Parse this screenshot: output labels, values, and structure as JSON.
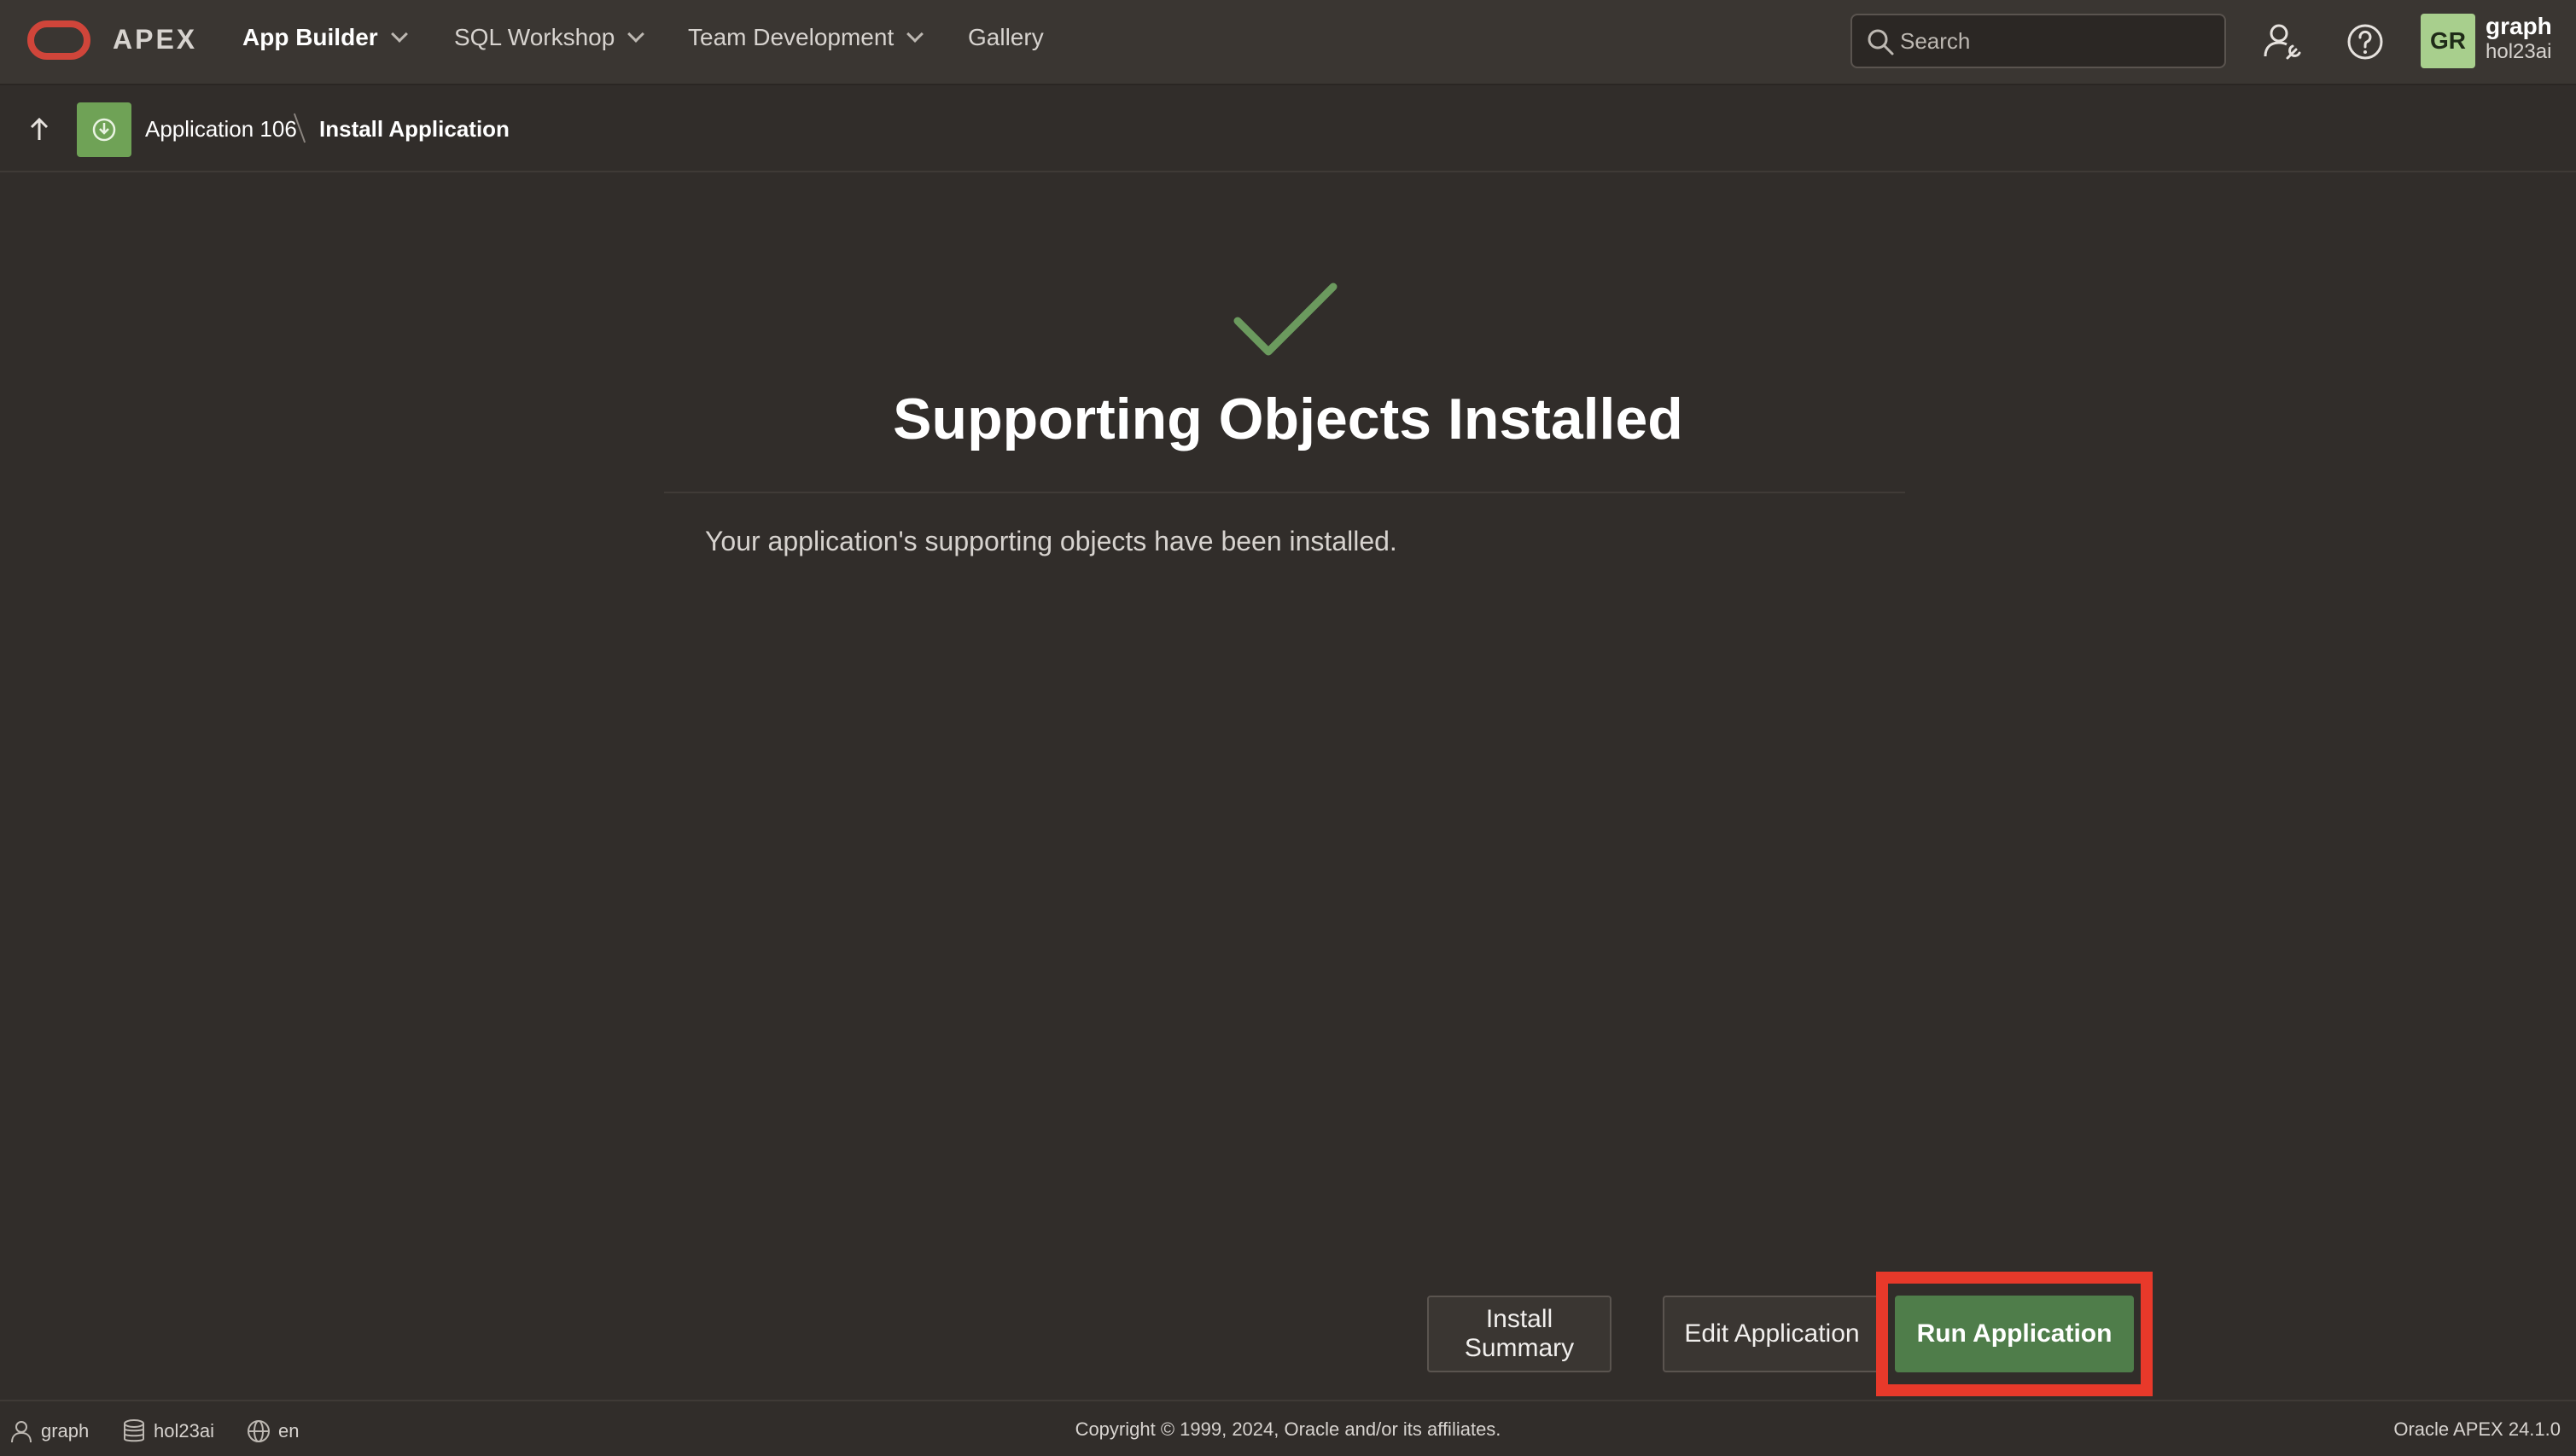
{
  "topbar": {
    "brand": "APEX",
    "nav": [
      {
        "label": "App Builder",
        "active": true,
        "has_menu": true
      },
      {
        "label": "SQL Workshop",
        "active": false,
        "has_menu": true
      },
      {
        "label": "Team Development",
        "active": false,
        "has_menu": true
      },
      {
        "label": "Gallery",
        "active": false,
        "has_menu": false
      }
    ],
    "search_placeholder": "Search",
    "avatar_initials": "GR",
    "user_name": "graph",
    "workspace": "hol23ai"
  },
  "breadcrumb": {
    "application": "Application 106",
    "current": "Install Application"
  },
  "main": {
    "heading": "Supporting Objects Installed",
    "message": "Your application's supporting objects have been installed."
  },
  "buttons": {
    "install_summary": "Install Summary",
    "edit_application": "Edit Application",
    "run_application": "Run Application"
  },
  "footer": {
    "user": "graph",
    "workspace": "hol23ai",
    "language": "en",
    "copyright": "Copyright © 1999, 2024, Oracle and/or its affiliates.",
    "version": "Oracle APEX 24.1.0"
  },
  "colors": {
    "background": "#312d2a",
    "topbar": "#3a3632",
    "primary_button": "#4f7d4a",
    "checkmark": "#6b9a5e",
    "highlight": "#e8392a",
    "oracle_red": "#d0453a"
  }
}
